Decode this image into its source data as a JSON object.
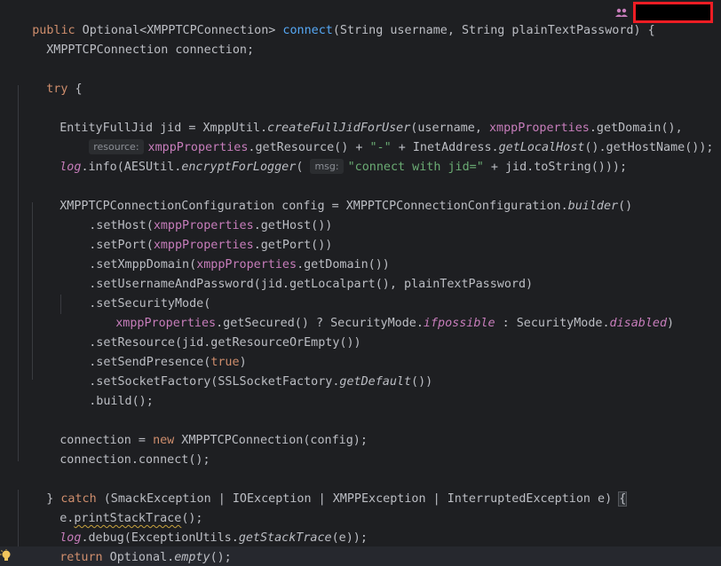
{
  "editor": {
    "theme": "dark",
    "colors": {
      "background": "#1e1f22",
      "keyword": "#cf8e6d",
      "method": "#56a8f5",
      "field": "#c77dbb",
      "string": "#6aab73",
      "text": "#bcbec4",
      "redaction_border": "#ee1d24"
    },
    "lines": {
      "l1": {
        "kw": "public",
        "t1": " Optional<XMPPTCPConnection> ",
        "fn": "connect",
        "t2": "(String username, String plainTextPassword) {"
      },
      "l2": {
        "t1": "XMPPTCPConnection connection;"
      },
      "l3": {
        "kw": "try",
        "t1": " {"
      },
      "l4": {
        "t1": "EntityFullJid jid = XmppUtil.",
        "m1": "createFullJidForUser",
        "t2": "(username, ",
        "f1": "xmppProperties",
        "t3": ".getDomain(),"
      },
      "l5": {
        "hint": "resource:",
        "f1": "xmppProperties",
        "t1": ".getResource() + ",
        "s1": "\"-\"",
        "t2": " + InetAddress.",
        "m1": "getLocalHost",
        "t3": "().getHostName());"
      },
      "l6": {
        "f0": "log",
        "t1": ".info(AESUtil.",
        "m1": "encryptForLogger",
        "t2": "( ",
        "hint": "msg:",
        "s1": "\"connect with jid=\"",
        "t3": " + jid.toString()));"
      },
      "l7": {
        "t1": "XMPPTCPConnectionConfiguration config = XMPPTCPConnectionConfiguration.",
        "m1": "builder",
        "t2": "()"
      },
      "l8": {
        "t1": ".setHost(",
        "f1": "xmppProperties",
        "t2": ".getHost())"
      },
      "l9": {
        "t1": ".setPort(",
        "f1": "xmppProperties",
        "t2": ".getPort())"
      },
      "l10": {
        "t1": ".setXmppDomain(",
        "f1": "xmppProperties",
        "t2": ".getDomain())"
      },
      "l11": {
        "t1": ".setUsernameAndPassword(jid.getLocalpart(), plainTextPassword)"
      },
      "l12": {
        "t1": ".setSecurityMode("
      },
      "l13": {
        "f1": "xmppProperties",
        "t1": ".getSecured() ? SecurityMode.",
        "c1": "ifpossible",
        "t2": " : SecurityMode.",
        "c2": "disabled",
        "t3": ")"
      },
      "l14": {
        "t1": ".setResource(jid.getResourceOrEmpty())"
      },
      "l15": {
        "t1": ".setSendPresence(",
        "kw": "true",
        "t2": ")"
      },
      "l16": {
        "t1": ".setSocketFactory(SSLSocketFactory.",
        "m1": "getDefault",
        "t2": "())"
      },
      "l17": {
        "t1": ".build();"
      },
      "l18": {
        "t1": "connection = ",
        "kw": "new",
        "t2": " XMPPTCPConnection(config);"
      },
      "l19": {
        "t1": "connection.connect();"
      },
      "l20": {
        "t1": "} ",
        "kw": "catch",
        "t2": " (SmackException | IOException | XMPPException | InterruptedException e) ",
        "t3": "{"
      },
      "l21": {
        "t1": "e.",
        "w1": "printStackTrace",
        "t2": "();"
      },
      "l22": {
        "f0": "log",
        "t1": ".debug(ExceptionUtils.",
        "m1": "getStackTrace",
        "t2": "(e));"
      },
      "l23": {
        "kw": "return",
        "t1": " Optional.",
        "m1": "empty",
        "t2": "();"
      },
      "l24": {
        "t1": "}"
      }
    },
    "icons": {
      "author": "people-icon",
      "bulb": "lightbulb-icon"
    }
  }
}
